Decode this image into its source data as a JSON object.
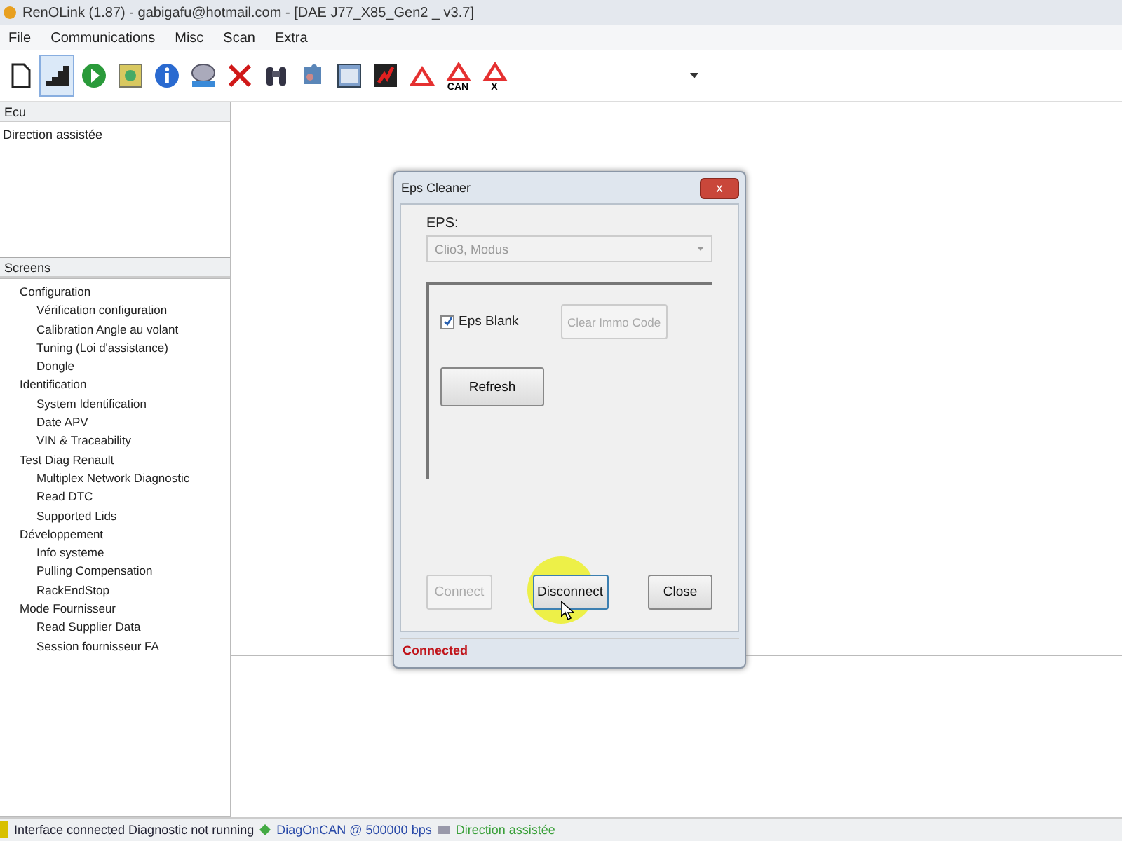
{
  "window": {
    "title": "RenOLink (1.87) - gabigafu@hotmail.com - [DAE J77_X85_Gen2 _ v3.7]"
  },
  "menu": [
    "File",
    "Communications",
    "Misc",
    "Scan",
    "Extra"
  ],
  "toolbar": [
    {
      "kind": "document",
      "selected": false
    },
    {
      "kind": "stairs",
      "selected": true
    },
    {
      "kind": "play",
      "selected": false
    },
    {
      "kind": "chip",
      "selected": false
    },
    {
      "kind": "info",
      "selected": false
    },
    {
      "kind": "device",
      "selected": false
    },
    {
      "kind": "cross",
      "selected": false
    },
    {
      "kind": "binoculars",
      "selected": false
    },
    {
      "kind": "puzzle",
      "selected": false
    },
    {
      "kind": "panel",
      "selected": false
    },
    {
      "kind": "chart",
      "selected": false
    },
    {
      "kind": "warning",
      "selected": false
    },
    {
      "kind": "warning",
      "selected": false,
      "label": "CAN"
    },
    {
      "kind": "warning",
      "selected": false,
      "label": "X"
    }
  ],
  "ecu_list": {
    "header": "Ecu",
    "items": [
      "Direction assistée"
    ]
  },
  "screens": {
    "header": "Screens",
    "tree": [
      {
        "label": "Configuration",
        "children": [
          {
            "label": "Vérification configuration"
          },
          {
            "label": "Calibration Angle au volant"
          },
          {
            "label": "Tuning (Loi d'assistance)"
          },
          {
            "label": "Dongle"
          }
        ]
      },
      {
        "label": "Identification",
        "children": [
          {
            "label": "System Identification"
          },
          {
            "label": "Date APV"
          },
          {
            "label": "VIN & Traceability"
          }
        ]
      },
      {
        "label": "Test Diag Renault",
        "children": [
          {
            "label": "Multiplex Network Diagnostic"
          },
          {
            "label": "Read DTC"
          },
          {
            "label": "Supported Lids"
          }
        ]
      },
      {
        "label": "Développement",
        "children": [
          {
            "label": "Info systeme"
          },
          {
            "label": "Pulling Compensation"
          },
          {
            "label": "RackEndStop"
          }
        ]
      },
      {
        "label": "Mode Fournisseur",
        "children": [
          {
            "label": "Read Supplier Data"
          },
          {
            "label": "Session fournisseur FA"
          }
        ]
      }
    ]
  },
  "dialog": {
    "title": "Eps Cleaner",
    "close": "x",
    "eps_label": "EPS:",
    "eps_value": "Clio3, Modus",
    "eps_disabled": true,
    "eps_blank": {
      "label": "Eps Blank",
      "checked": true
    },
    "clear_immo": {
      "label": "Clear Immo Code",
      "disabled": true
    },
    "refresh": {
      "label": "Refresh",
      "disabled": false
    },
    "buttons": [
      {
        "label": "Connect",
        "disabled": true,
        "focused": false
      },
      {
        "label": "Disconnect",
        "disabled": false,
        "focused": true
      },
      {
        "label": "Close",
        "disabled": false,
        "focused": false
      }
    ],
    "status": "Connected"
  },
  "status_bar": {
    "interface": "Interface connected Diagnostic not running",
    "protocol": "DiagOnCAN @ 500000 bps",
    "ecu": "Direction assistée"
  }
}
